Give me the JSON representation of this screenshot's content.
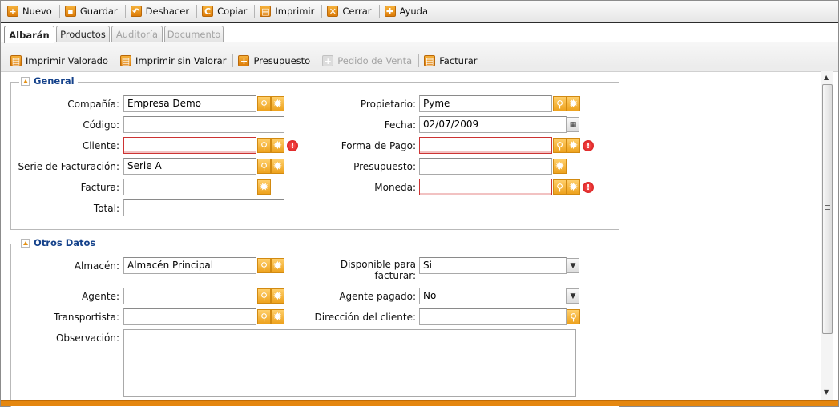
{
  "toolbar": {
    "nuevo": "Nuevo",
    "guardar": "Guardar",
    "deshacer": "Deshacer",
    "copiar": "Copiar",
    "imprimir": "Imprimir",
    "cerrar": "Cerrar",
    "ayuda": "Ayuda"
  },
  "tabs": [
    {
      "label": "Albarán",
      "state": "active"
    },
    {
      "label": "Productos",
      "state": "enabled"
    },
    {
      "label": "Auditoría",
      "state": "disabled"
    },
    {
      "label": "Documento",
      "state": "disabled"
    }
  ],
  "actions": {
    "imprimir_valorado": "Imprimir Valorado",
    "imprimir_sin_valorar": "Imprimir sin Valorar",
    "presupuesto": "Presupuesto",
    "pedido_de_venta": "Pedido de Venta",
    "facturar": "Facturar"
  },
  "general": {
    "title": "General",
    "compania_label": "Compañía:",
    "compania_value": "Empresa Demo",
    "codigo_label": "Código:",
    "codigo_value": "",
    "cliente_label": "Cliente:",
    "cliente_value": "",
    "serie_label": "Serie de Facturación:",
    "serie_value": "Serie A",
    "factura_label": "Factura:",
    "factura_value": "",
    "total_label": "Total:",
    "total_value": "",
    "propietario_label": "Propietario:",
    "propietario_value": "Pyme",
    "fecha_label": "Fecha:",
    "fecha_value": "02/07/2009",
    "forma_pago_label": "Forma de Pago:",
    "forma_pago_value": "",
    "presupuesto_label": "Presupuesto:",
    "presupuesto_value": "",
    "moneda_label": "Moneda:",
    "moneda_value": ""
  },
  "otros": {
    "title": "Otros Datos",
    "almacen_label": "Almacén:",
    "almacen_value": "Almacén Principal",
    "agente_label": "Agente:",
    "agente_value": "",
    "transportista_label": "Transportista:",
    "transportista_value": "",
    "observacion_label": "Observación:",
    "observacion_value": "",
    "disponible_label_1": "Disponible para",
    "disponible_label_2": "facturar:",
    "disponible_value": "Si",
    "agente_pagado_label": "Agente pagado:",
    "agente_pagado_value": "No",
    "direccion_label": "Dirección del cliente:",
    "direccion_value": ""
  },
  "colors": {
    "accent": "#e5870f",
    "legend": "#15428b",
    "error": "#cc1111"
  }
}
